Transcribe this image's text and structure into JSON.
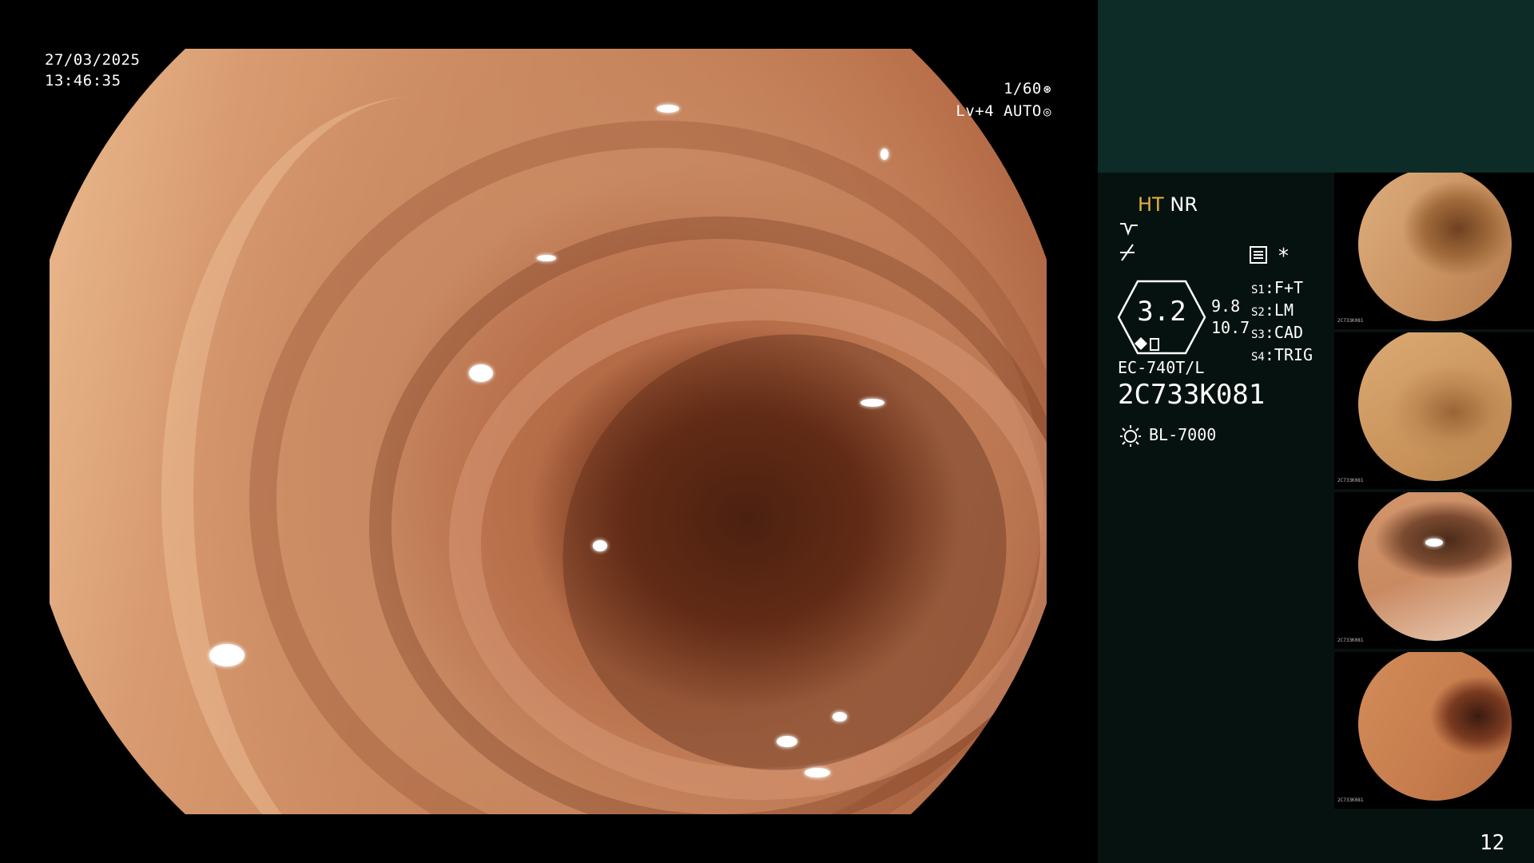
{
  "overlay": {
    "date": "27/03/2025",
    "time": "13:46:35",
    "shutter": "1/60",
    "level": "Lv+4",
    "mode": "AUTO"
  },
  "panel": {
    "ht_label": "HT",
    "nr_label": "NR",
    "zoom_value": "3.2",
    "value_a": "9.8",
    "value_b": "10.7",
    "presets": [
      {
        "key": "S1",
        "value": "F+T"
      },
      {
        "key": "S2",
        "value": "LM"
      },
      {
        "key": "S3",
        "value": "CAD"
      },
      {
        "key": "S4",
        "value": "TRIG"
      }
    ],
    "asterisk": "*",
    "scope_model": "EC-740T/L",
    "scope_serial": "2C733K081",
    "light_source": "BL-7000",
    "image_count": "12",
    "ht_color": "#e8b040"
  },
  "thumbnails": [
    {
      "label": "2C733K081"
    },
    {
      "label": "2C733K081"
    },
    {
      "label": "2C733K081"
    },
    {
      "label": "2C733K081"
    }
  ]
}
